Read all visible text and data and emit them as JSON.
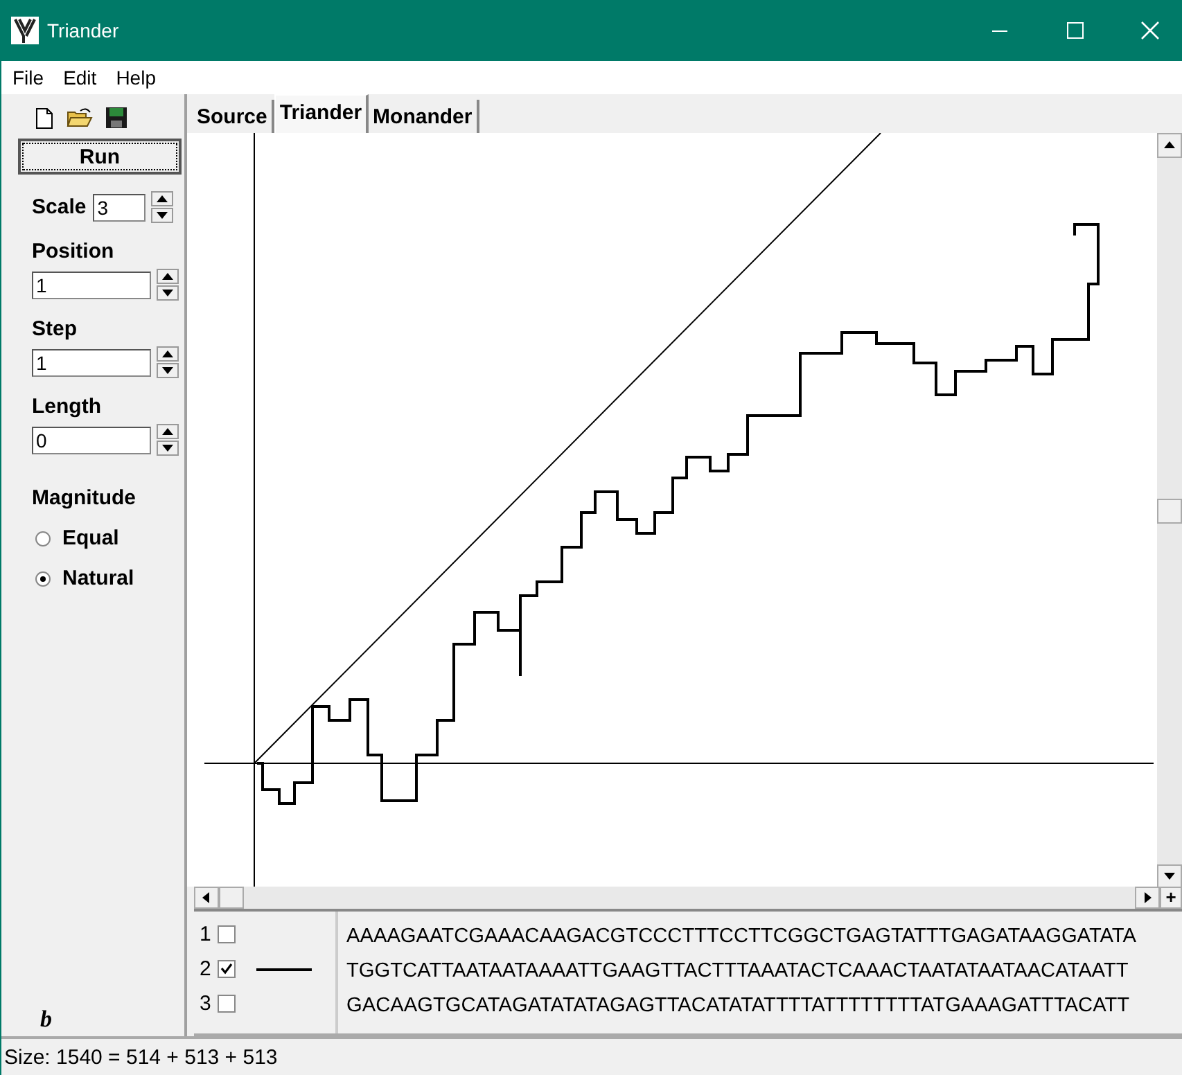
{
  "window": {
    "title": "Triander"
  },
  "menu": [
    "File",
    "Edit",
    "Help"
  ],
  "toolbar": {
    "run_button": "Run"
  },
  "controls": [
    {
      "label": "Scale",
      "value": "3",
      "kind": "short"
    },
    {
      "label": "Position",
      "value": "1",
      "kind": "wide"
    },
    {
      "label": "Step",
      "value": "1",
      "kind": "wide"
    },
    {
      "label": "Length",
      "value": "0",
      "kind": "wide"
    }
  ],
  "magnitude": {
    "label": "Magnitude",
    "options": [
      {
        "label": "Equal",
        "selected": false
      },
      {
        "label": "Natural",
        "selected": true
      }
    ]
  },
  "figure_label": "b",
  "tabs": [
    {
      "label": "Source",
      "selected": false
    },
    {
      "label": "Triander",
      "selected": true
    },
    {
      "label": "Monander",
      "selected": false
    }
  ],
  "plot": {
    "kind": "picture"
  },
  "scroll_plus": "+",
  "sequences": [
    {
      "number": "1",
      "checked": false,
      "text": "AAAAGAATCGAAACAAGACGTCCCTTTCCTTCGGCTGAGTATTTGAGATAAGGATATA"
    },
    {
      "number": "2",
      "checked": true,
      "text": "TGGTCATTAATAATAAAATTGAAGTTACTTTAAATACTCAAACTAATATAATAACATAATT"
    },
    {
      "number": "3",
      "checked": false,
      "text": "GACAAGTGCATAGATATATAGAGTTACATATATTTTATTTTTTTTATGAAAGATTTACATT"
    }
  ],
  "status_bar": "Size: 1540 = 514 + 513 + 513"
}
